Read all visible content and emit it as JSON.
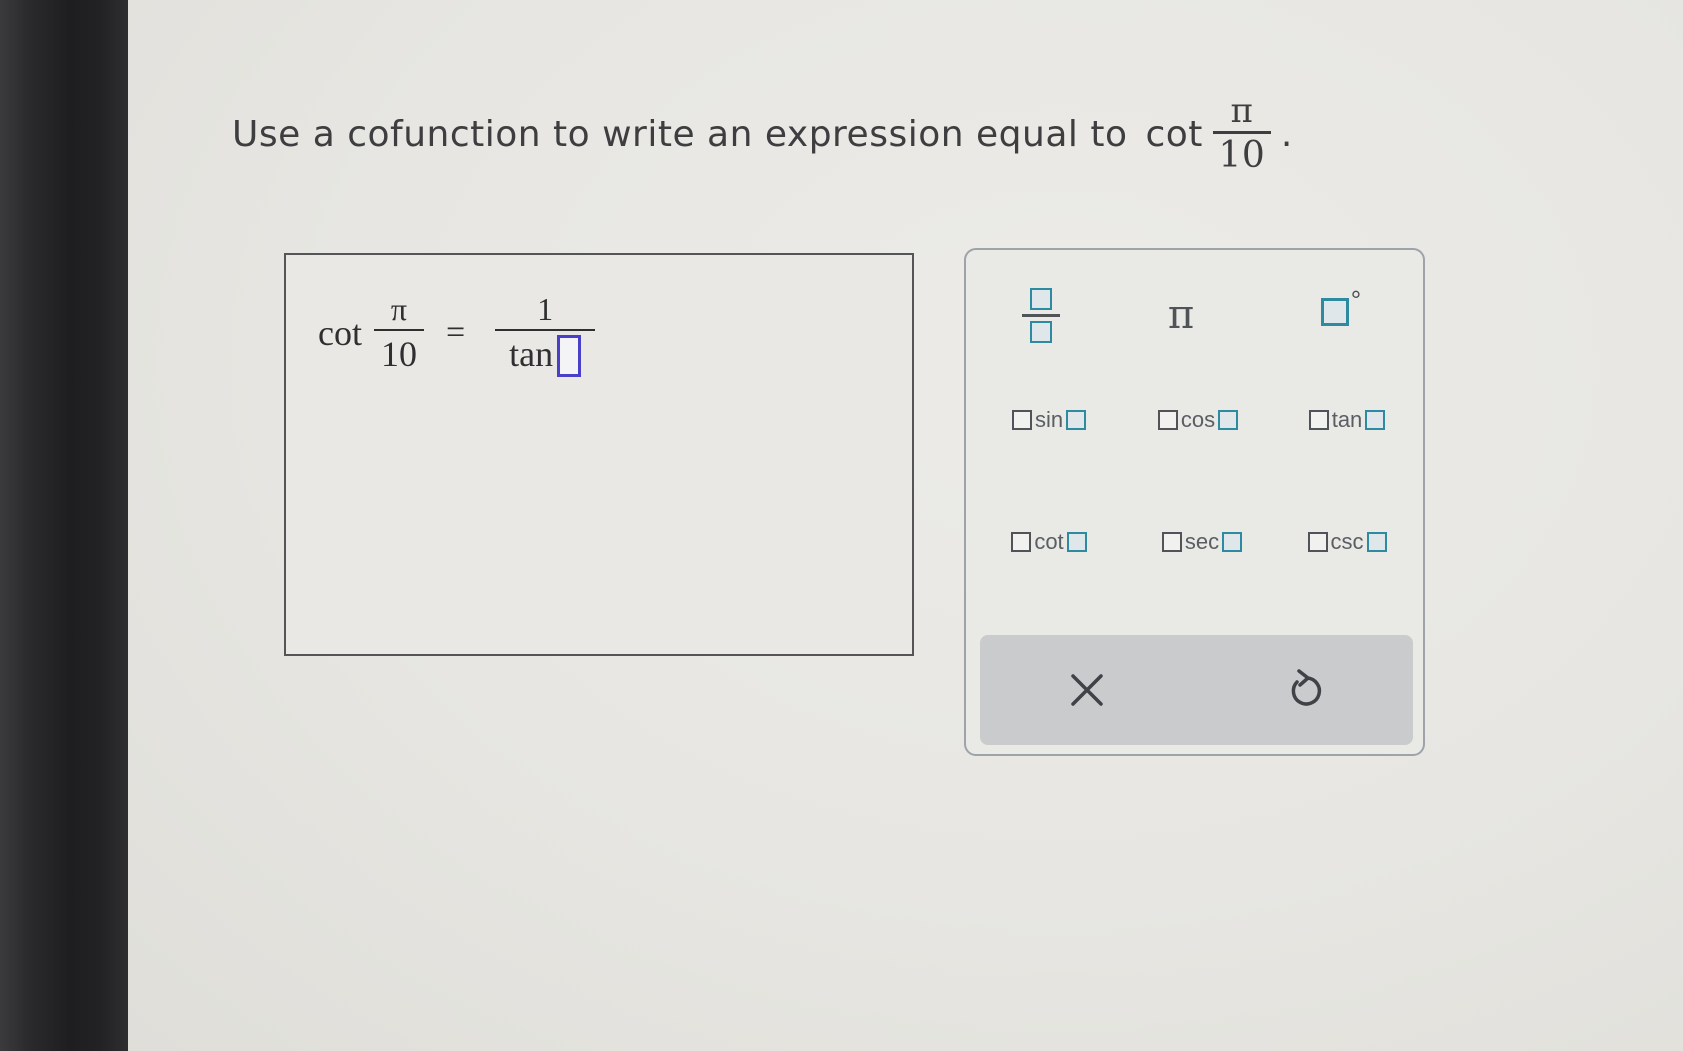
{
  "question": {
    "text": "Use a cofunction to write an expression equal to",
    "func": "cot",
    "numerator": "π",
    "denominator": "10",
    "end": "."
  },
  "answer": {
    "lhs_func": "cot",
    "lhs_num": "π",
    "lhs_den": "10",
    "equals": "=",
    "rhs_num": "1",
    "rhs_func": "tan"
  },
  "palette": {
    "pi": "π",
    "degree": "°",
    "functions": [
      "sin",
      "cos",
      "tan",
      "cot",
      "sec",
      "csc"
    ],
    "clear_icon": "close-icon",
    "undo_icon": "undo-icon"
  },
  "colors": {
    "cursor_box": "#4a3fc8",
    "slot_accent": "#2e8aa0"
  }
}
